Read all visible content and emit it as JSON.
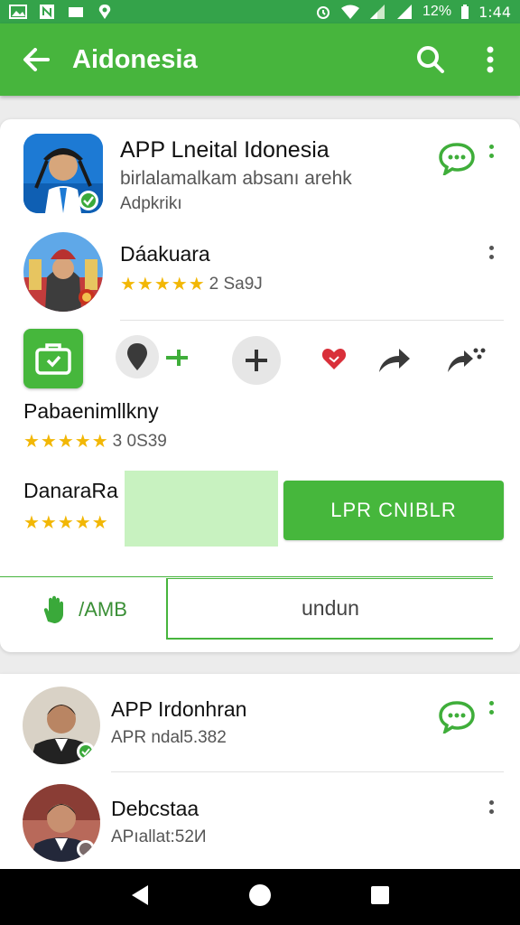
{
  "status_bar": {
    "time": "1:44",
    "battery": "12%",
    "icons": [
      "image-icon",
      "notification-icon",
      "mail-icon",
      "location-icon",
      "alarm-icon",
      "wifi-icon",
      "signal-icon",
      "signal-icon",
      "battery-icon"
    ]
  },
  "app_bar": {
    "title": "Aidonesia",
    "back_icon": "arrow-left-icon",
    "search_icon": "search-icon",
    "menu_icon": "more-vert-icon"
  },
  "card1": {
    "header": {
      "title": "APP Lneital Idonesia",
      "subtitle": "birlalamalkam absanı arehk",
      "caption": "Adpkrikı",
      "chat_icon": "chat-bubble-icon"
    },
    "user1": {
      "name": "Dáakuara",
      "stars": "★★★★★",
      "rating": "2 Sa9J"
    },
    "action_row": [
      "briefcase-icon",
      "location-pin-icon",
      "plus-icon",
      "heart-icon",
      "share-icon",
      "more-share-icon"
    ],
    "item2": {
      "name": "Pabaenimllkny",
      "stars": "★★★★★",
      "rating": "3 0S39"
    },
    "item3": {
      "name": "DanaraRa",
      "stars": "★★★★★"
    },
    "primary_button": "LPR CNIBLR",
    "tab_label": "/AMB",
    "input_value": "undun"
  },
  "card2": {
    "user1": {
      "name": "APP Irdonhran",
      "subtitle": "APR ndal5.382"
    },
    "user2": {
      "name": "Debcstaa",
      "subtitle": "APıallat:52И"
    }
  },
  "colors": {
    "brand_green": "#47b53d",
    "status_green": "#34a34a",
    "star_yellow": "#f2b705",
    "light_green": "#c8f2c0"
  }
}
